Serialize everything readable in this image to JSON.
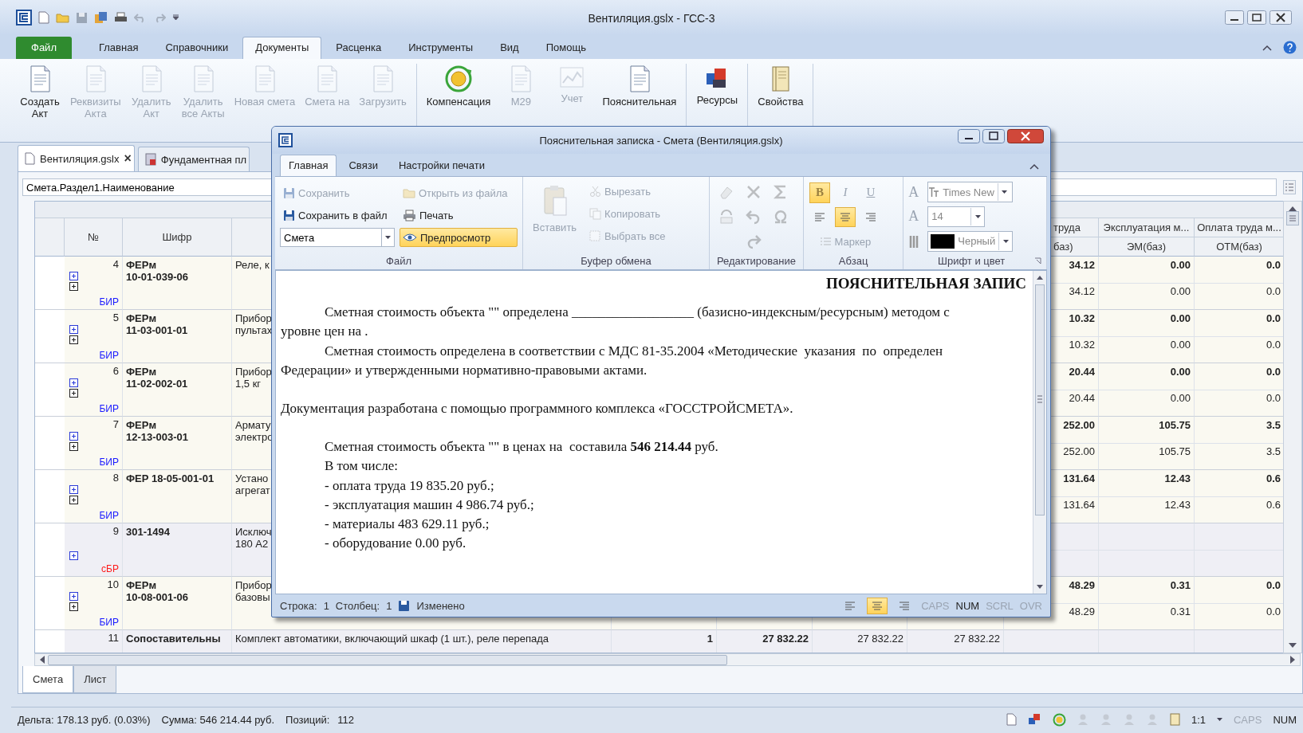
{
  "window": {
    "title": "Вентиляция.gslx - ГСС-3"
  },
  "menu_tabs": [
    {
      "label": "Файл",
      "kind": "file",
      "selected": false
    },
    {
      "label": "Главная",
      "kind": "tab",
      "selected": false
    },
    {
      "label": "Справочники",
      "kind": "tab",
      "selected": false
    },
    {
      "label": "Документы",
      "kind": "tab",
      "selected": true
    },
    {
      "label": "Расценка",
      "kind": "tab",
      "selected": false
    },
    {
      "label": "Инструменты",
      "kind": "tab",
      "selected": false
    },
    {
      "label": "Вид",
      "kind": "tab",
      "selected": false
    },
    {
      "label": "Помощь",
      "kind": "tab",
      "selected": false
    }
  ],
  "ribbon_groups": [
    {
      "buttons": [
        {
          "label": "Создать\nАкт",
          "kind": "doc",
          "disabled": false
        },
        {
          "label": "Реквизиты\nАкта",
          "kind": "doc",
          "disabled": true
        },
        {
          "label": "Удалить\nАкт",
          "kind": "doc",
          "disabled": true
        },
        {
          "label": "Удалить\nвсе Акты",
          "kind": "doc",
          "disabled": true
        },
        {
          "label": "Новая смета",
          "kind": "doc",
          "disabled": true
        },
        {
          "label": "Смета на",
          "kind": "doc",
          "disabled": true
        },
        {
          "label": "Загрузить",
          "kind": "doc",
          "disabled": true
        }
      ]
    },
    {
      "buttons": [
        {
          "label": "Компенсация",
          "kind": "coin",
          "disabled": false
        },
        {
          "label": "М29",
          "kind": "doc",
          "disabled": true
        },
        {
          "label": "Учет",
          "kind": "chart",
          "disabled": true
        },
        {
          "label": "Пояснительная",
          "kind": "doc",
          "disabled": false
        }
      ]
    },
    {
      "buttons": [
        {
          "label": "Ресурсы",
          "kind": "blocks",
          "disabled": false
        }
      ]
    },
    {
      "buttons": [
        {
          "label": "Свойства",
          "kind": "book",
          "disabled": false
        }
      ]
    }
  ],
  "doc_tabs": [
    {
      "label": "Вентиляция.gslx",
      "close": "×",
      "selected": true
    },
    {
      "label": "Фундаментная пл",
      "selected": false
    }
  ],
  "formula_bar": {
    "value": "Смета.Раздел1.Наименование"
  },
  "table": {
    "left_columns": [
      {
        "label": "№"
      },
      {
        "label": "Шифр"
      }
    ],
    "right_columns": [
      {
        "label": "труда",
        "sub": "баз)"
      },
      {
        "label": "Эксплуатация м...",
        "sub": "ЭМ(баз)"
      },
      {
        "label": "Оплата труда м...",
        "sub": "ОТМ(баз)"
      }
    ],
    "rows": [
      {
        "number": "4",
        "kind": "work",
        "code_lines": [
          "ФЕРм",
          "10-01-039-06"
        ],
        "name_lines": [
          "Реле, к"
        ],
        "tag": "БИР",
        "totals": [
          "34.12",
          "0.00",
          "0.0"
        ],
        "base": [
          "34.12",
          "0.00",
          "0.0"
        ]
      },
      {
        "number": "5",
        "kind": "work",
        "code_lines": [
          "ФЕРм",
          "11-03-001-01"
        ],
        "name_lines": [
          "Прибор",
          "пультах"
        ],
        "tag": "БИР",
        "totals": [
          "10.32",
          "0.00",
          "0.0"
        ],
        "base": [
          "10.32",
          "0.00",
          "0.0"
        ]
      },
      {
        "number": "6",
        "kind": "work",
        "code_lines": [
          "ФЕРм",
          "11-02-002-01"
        ],
        "name_lines": [
          "Прибор",
          "1,5 кг"
        ],
        "tag": "БИР",
        "totals": [
          "20.44",
          "0.00",
          "0.0"
        ],
        "base": [
          "20.44",
          "0.00",
          "0.0"
        ]
      },
      {
        "number": "7",
        "kind": "work",
        "code_lines": [
          "ФЕРм",
          "12-13-003-01"
        ],
        "name_lines": [
          "Армату",
          "электро"
        ],
        "tag": "БИР",
        "totals": [
          "252.00",
          "105.75",
          "3.5"
        ],
        "base": [
          "252.00",
          "105.75",
          "3.5"
        ]
      },
      {
        "number": "8",
        "kind": "work",
        "code_lines": [
          "ФЕР 18-05-001-01"
        ],
        "name_lines": [
          "Устано",
          "агрегат"
        ],
        "tag": "БИР",
        "totals": [
          "131.64",
          "12.43",
          "0.6"
        ],
        "base": [
          "131.64",
          "12.43",
          "0.6"
        ]
      },
      {
        "number": "9",
        "kind": "resource",
        "code_lines": [
          "301-1494"
        ],
        "name_lines": [
          "Исключ",
          "180 А2"
        ],
        "tag": "сБР"
      },
      {
        "number": "10",
        "kind": "work",
        "code_lines": [
          "ФЕРм",
          "10-08-001-06"
        ],
        "name_lines": [
          "Прибор",
          "базовы"
        ],
        "tag": "БИР",
        "totals": [
          "48.29",
          "0.31",
          "0.0"
        ],
        "base": [
          "48.29",
          "0.31",
          "0.0"
        ]
      },
      {
        "number": "11",
        "kind": "resource",
        "code_lines": [
          "Сопоставительны"
        ],
        "name_lines": [
          "Комплект автоматики, включающий шкаф (1 шт.), реле перепада"
        ],
        "middle": [
          "1",
          "27 832.22",
          "27 832.22",
          "27 832.22"
        ]
      }
    ]
  },
  "sheet_tabs": [
    {
      "label": "Смета",
      "selected": true
    },
    {
      "label": "Лист",
      "selected": false
    }
  ],
  "status_bar": {
    "delta": "Дельта: 178.13 руб. (0.03%)",
    "sum": "Сумма: 546 214.44 руб.",
    "positions_label": "Позиций:",
    "positions": "112",
    "zoom": "1:1",
    "indicators": [
      {
        "label": "CAPS",
        "on": false
      },
      {
        "label": "NUM",
        "on": true
      }
    ]
  },
  "dialog": {
    "title": "Пояснительная записка - Смета (Вентиляция.gslx)",
    "tabs": [
      {
        "label": "Главная",
        "selected": true
      },
      {
        "label": "Связи",
        "selected": false
      },
      {
        "label": "Настройки печати",
        "selected": false
      }
    ],
    "file": {
      "label": "Файл",
      "buttons": [
        {
          "label": "Сохранить",
          "kind": "save",
          "disabled": true
        },
        {
          "label": "Открыть из файла",
          "kind": "open",
          "disabled": true
        },
        {
          "label": "Сохранить в файл",
          "kind": "save",
          "disabled": false
        },
        {
          "label": "Печать",
          "kind": "print",
          "disabled": false
        }
      ],
      "select": {
        "value": "Смета"
      },
      "preview": {
        "label": "Предпросмотр",
        "active": true
      }
    },
    "clipboard": {
      "label": "Буфер обмена",
      "paste": {
        "label": "Вставить",
        "disabled": true
      },
      "buttons": [
        {
          "label": "Вырезать",
          "kind": "cut",
          "disabled": true
        },
        {
          "label": "Копировать",
          "kind": "copy",
          "disabled": true
        },
        {
          "label": "Выбрать все",
          "kind": "select_all",
          "disabled": true
        }
      ]
    },
    "editing": {
      "label": "Редактирование",
      "disabled": true
    },
    "paragraph": {
      "label": "Абзац",
      "styles": [
        {
          "label": "B",
          "kind": "bold",
          "on": true
        },
        {
          "label": "I",
          "kind": "italic",
          "on": false
        },
        {
          "label": "U",
          "kind": "underline",
          "on": false
        }
      ],
      "align": [
        {
          "kind": "left",
          "selected": false
        },
        {
          "kind": "center",
          "selected": true
        },
        {
          "kind": "right",
          "selected": false
        }
      ],
      "bullets": {
        "label": "Маркер",
        "disabled": true
      }
    },
    "font": {
      "label": "Шрифт и цвет",
      "glyph": "A",
      "name": "Times New",
      "size_glyph": "A",
      "size": "14",
      "color_name": "Черный",
      "color": "#000000"
    },
    "document": {
      "heading": "ПОЯСНИТЕЛЬНАЯ ЗАПИС",
      "lines": [
        {
          "text": "Сметная стоимость объекта \"\" определена __________________ (базисно-индексным/ресурсным) методом с",
          "indent": true,
          "gap_before": false
        },
        {
          "text": "уровне цен на .",
          "indent": false,
          "gap_before": false
        },
        {
          "text": "Сметная стоимость определена в соответствии с МДС 81-35.2004 «Методические  указания  по  определен",
          "indent": true,
          "gap_before": false
        },
        {
          "text": "Федерации» и утвержденными нормативно-правовыми актами.",
          "indent": false,
          "gap_before": false
        },
        {
          "text": "Документация разработана с помощью программного комплекса «ГОССТРОЙСМЕТА».",
          "indent": false,
          "gap_before": true
        },
        {
          "text": "Сметная стоимость объекта \"\" в ценах на  составила **546 214.44** руб.",
          "indent": true,
          "gap_before": true
        },
        {
          "text": "В том числе:",
          "indent": true,
          "gap_before": false
        },
        {
          "text": "- оплата труда 19 835.20 руб.;",
          "indent": true,
          "gap_before": false
        },
        {
          "text": "- эксплуатация машин 4 986.74 руб.;",
          "indent": true,
          "gap_before": false
        },
        {
          "text": "- материалы 483 629.11 руб.;",
          "indent": true,
          "gap_before": false
        },
        {
          "text": "- оборудование 0.00 руб.",
          "indent": true,
          "gap_before": false
        }
      ]
    },
    "status": {
      "row_label": "Строка:",
      "row": "1",
      "col_label": "Столбец:",
      "col": "1",
      "state": "Изменено",
      "align": [
        {
          "kind": "left",
          "selected": false
        },
        {
          "kind": "center",
          "selected": true
        },
        {
          "kind": "right",
          "selected": false
        }
      ],
      "indicators": [
        {
          "label": "CAPS",
          "on": false
        },
        {
          "label": "NUM",
          "on": true
        },
        {
          "label": "SCRL",
          "on": false
        },
        {
          "label": "OVR",
          "on": false
        }
      ]
    }
  }
}
